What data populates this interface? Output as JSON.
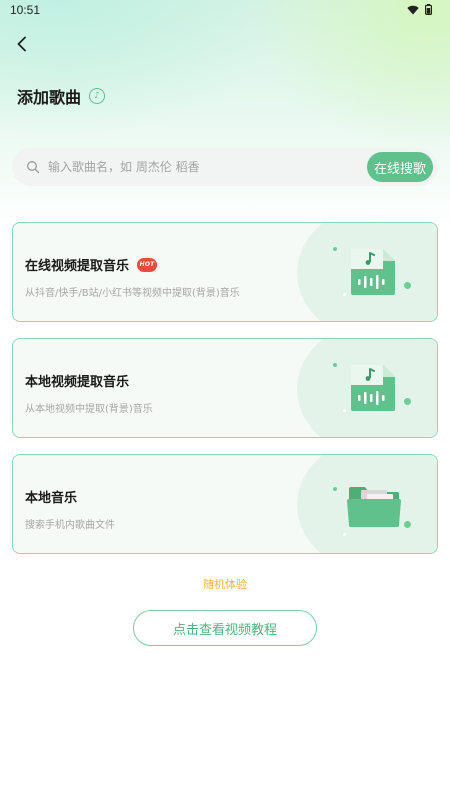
{
  "status_bar": {
    "time": "10:51",
    "icons": [
      "wifi-icon",
      "battery-icon"
    ]
  },
  "header": {
    "title": "添加歌曲",
    "back_icon": "chevron-left-icon",
    "title_icon": "music-note-icon"
  },
  "search": {
    "placeholder": "输入歌曲名，如 周杰伦 稻香",
    "button_label": "在线搜歌"
  },
  "cards": [
    {
      "title": "在线视频提取音乐",
      "badge": "HOT",
      "subtitle": "从抖音/快手/B站/小红书等视频中提取(背景)音乐",
      "icon": "music-file-icon"
    },
    {
      "title": "本地视频提取音乐",
      "subtitle": "从本地视频中提取(背景)音乐",
      "icon": "music-file-icon"
    },
    {
      "title": "本地音乐",
      "subtitle": "搜索手机内歌曲文件",
      "icon": "folder-icon"
    }
  ],
  "random_link": "随机体验",
  "tutorial_button": "点击查看视频教程",
  "colors": {
    "accent": "#5fc28c",
    "card_border": "#8fd9b0",
    "hot_badge": "#f04a3a",
    "random_link": "#f5b433"
  }
}
